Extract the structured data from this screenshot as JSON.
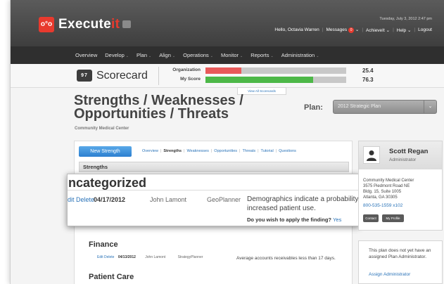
{
  "app": {
    "logo_text": "o°o",
    "brand_main": "Execute",
    "brand_suffix": "it"
  },
  "topbar": {
    "datetime": "Tuesday, July 3, 2012 2:47 pm",
    "greeting": "Hello, Octavia Warren",
    "messages_label": "Messages",
    "messages_count": "0",
    "achieveit_label": "AchieveIt",
    "help_label": "Help",
    "logout_label": "Logout"
  },
  "mainnav": {
    "items": [
      {
        "label": "Overview",
        "has_menu": false
      },
      {
        "label": "Develop",
        "has_menu": true
      },
      {
        "label": "Plan",
        "has_menu": true
      },
      {
        "label": "Align",
        "has_menu": true
      },
      {
        "label": "Operations",
        "has_menu": true
      },
      {
        "label": "Monitor",
        "has_menu": true
      },
      {
        "label": "Reports",
        "has_menu": true
      },
      {
        "label": "Administration",
        "has_menu": true
      }
    ]
  },
  "scorecard": {
    "icon_text": "97",
    "title": "Scorecard",
    "rows": [
      {
        "label": "Organization",
        "value": "25.4",
        "fill_fraction": 0.254,
        "color": "#e85a5a"
      },
      {
        "label": "My Score",
        "value": "76.3",
        "fill_fraction": 0.763,
        "color": "#4db848"
      }
    ],
    "view_all_label": "View All Scorecards"
  },
  "page": {
    "title": "Strengths / Weaknesses / Opportunities / Threats",
    "organization": "Community Medical Center",
    "plan_label": "Plan:",
    "plan_value": "2012 Strategic Plan"
  },
  "toolbar": {
    "new_button": "New Strength",
    "tabs": [
      "Overview",
      "Strengths",
      "Weaknesses",
      "Opportunities",
      "Threats",
      "Tutorial",
      "Questions"
    ],
    "active_tab": "Strengths"
  },
  "section": {
    "title": "Strengths"
  },
  "callout": {
    "category": "Uncategorized",
    "actions": "Edit Delete",
    "date": "04/17/2012",
    "owner": "John Lamont",
    "source": "GeoPlanner",
    "description": "Demographics indicate a probability of increased patient use.",
    "question": "Do you wish to apply the finding?",
    "question_link": "Yes"
  },
  "groups": [
    {
      "title": "Finance",
      "entries": [
        {
          "actions": "Edit Delete",
          "date": "04/13/2012",
          "owner": "John Lamont",
          "source": "StrategyPlanner",
          "description": "Average accounts receivables less than 17 days."
        }
      ]
    },
    {
      "title": "Patient Care",
      "entries": []
    }
  ],
  "profile": {
    "name": "Scott Regan",
    "role": "Administrator",
    "address_lines": [
      "Community Medical Center",
      "3575 Piedmont Road NE",
      "Bldg. 15, Suite 1005",
      "Atlanta, GA 30305"
    ],
    "phone": "800-535-1559 x102",
    "contact_button": "Contact",
    "profile_button": "My Profile"
  },
  "admin_notice": {
    "text": "This plan does not yet have an assigned Plan Administrator.",
    "link": "Assign Administrator"
  }
}
